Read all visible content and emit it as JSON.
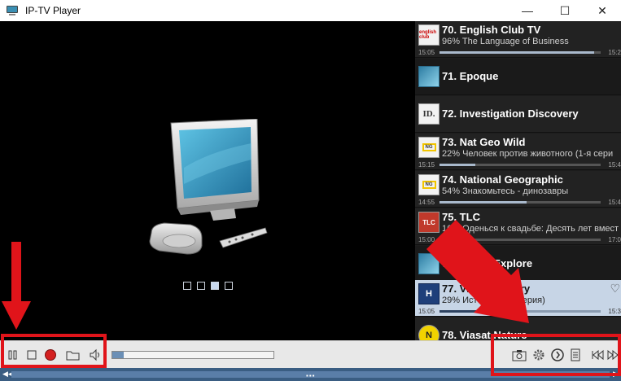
{
  "window": {
    "title": "IP-TV Player",
    "minimize_glyph": "—",
    "maximize_glyph": "☐",
    "close_glyph": "✕"
  },
  "video": {
    "placeholder_icon": "tv-monitor-icon",
    "slides": 4,
    "active_slide": 3
  },
  "channels": [
    {
      "num_name": "70. English Club TV",
      "program": "96% The Language of Business",
      "start": "15:05",
      "end": "15:2",
      "progress": 0.96,
      "logo": "english club",
      "layout": "full"
    },
    {
      "num_name": "71. Epoque",
      "layout": "simple",
      "logo": ""
    },
    {
      "num_name": "72. Investigation Discovery",
      "layout": "simple",
      "logo": "ID."
    },
    {
      "num_name": "73. Nat Geo Wild",
      "program": "22% Человек против животного (1-я сери",
      "start": "15:15",
      "end": "15:4",
      "progress": 0.22,
      "logo": "NG",
      "layout": "full"
    },
    {
      "num_name": "74. National Geographic",
      "program": "54% Знакомьтесь - динозавры",
      "start": "14:55",
      "end": "15:4",
      "progress": 0.54,
      "logo": "NG",
      "layout": "full"
    },
    {
      "num_name": "75. TLC",
      "program": "16% Оденься к свадьбе: Десять лет вмест",
      "start": "15:00",
      "end": "17:0",
      "progress": 0.16,
      "logo": "TLC",
      "layout": "full"
    },
    {
      "num_name": "76. Viasat Explore",
      "layout": "simple",
      "logo": ""
    },
    {
      "num_name": "77. Viasat History",
      "program": "29% История (6-я серия)",
      "start": "15:05",
      "end": "15:3",
      "progress": 0.29,
      "logo": "H",
      "layout": "full",
      "selected": true
    },
    {
      "num_name": "78. Viasat Nature",
      "layout": "simple",
      "logo": "N"
    }
  ],
  "controls": {
    "pause": "pause-icon",
    "stop": "stop-icon",
    "record": "record-icon",
    "open": "folder-icon",
    "volume": "speaker-icon",
    "seek_progress": 0.0,
    "snapshot": "camera-icon",
    "settings": "gear-icon",
    "schedule": "clock-icon",
    "playlist": "list-icon",
    "prev": "previous-icon",
    "next": "next-icon"
  },
  "colors": {
    "highlight": "#e0141a",
    "selected_row": "#c7d5e6",
    "record": "#d32020"
  }
}
